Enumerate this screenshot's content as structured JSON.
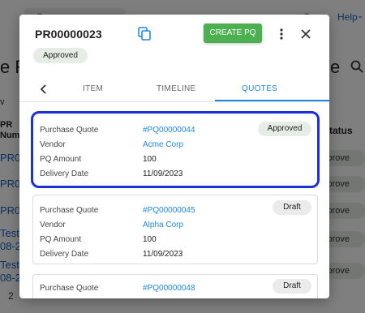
{
  "background": {
    "search_text": "a Cus",
    "topright_text": "S",
    "help_label": "Help",
    "heading_left": "e Re",
    "heading_right": "e",
    "view_letter": "v",
    "pr_header": [
      "PR",
      "Numbe"
    ],
    "status_header": "tatus",
    "rows": [
      {
        "link": [
          "PR00"
        ],
        "status": "Approve"
      },
      {
        "link": [
          "PR00"
        ],
        "status": "Approve"
      },
      {
        "link": [
          "PR00"
        ],
        "status": "Approve"
      },
      {
        "link": [
          "Test-P",
          "08-20"
        ],
        "status": "Approve"
      },
      {
        "link": [
          "Test-P",
          "08-20"
        ],
        "status": "Approve"
      }
    ],
    "page_number": "2"
  },
  "modal": {
    "title": "PR00000023",
    "create_button": "CREATE PQ",
    "status": "Approved",
    "tabs": [
      {
        "label": "ITEM",
        "active": false
      },
      {
        "label": "TIMELINE",
        "active": false
      },
      {
        "label": "QUOTES",
        "active": true
      }
    ],
    "field_labels": {
      "quote": "Purchase Quote",
      "vendor": "Vendor",
      "amount": "PQ Amount",
      "date": "Delivery Date"
    },
    "quotes": [
      {
        "id": "#PQ00000044",
        "vendor": "Acme Corp",
        "amount": "100",
        "date": "11/09/2023",
        "status": "Approved",
        "selected": true
      },
      {
        "id": "#PQ00000045",
        "vendor": "Alpha Corp",
        "amount": "100",
        "date": "11/09/2023",
        "status": "Draft",
        "selected": false
      },
      {
        "id": "#PQ00000048",
        "vendor": "",
        "amount": "",
        "date": "",
        "status": "Draft",
        "selected": false
      }
    ]
  },
  "colors": {
    "accent_blue": "#1e88e5",
    "create_green": "#4caf50",
    "selection_outline": "#1c2fd8",
    "approved_badge": "#e6ece6",
    "draft_badge": "#ebebeb"
  },
  "icons": {
    "copy": "copy-icon",
    "more": "more-vertical-icon",
    "close": "close-icon",
    "back": "chevron-left-icon",
    "search": "search-icon"
  }
}
